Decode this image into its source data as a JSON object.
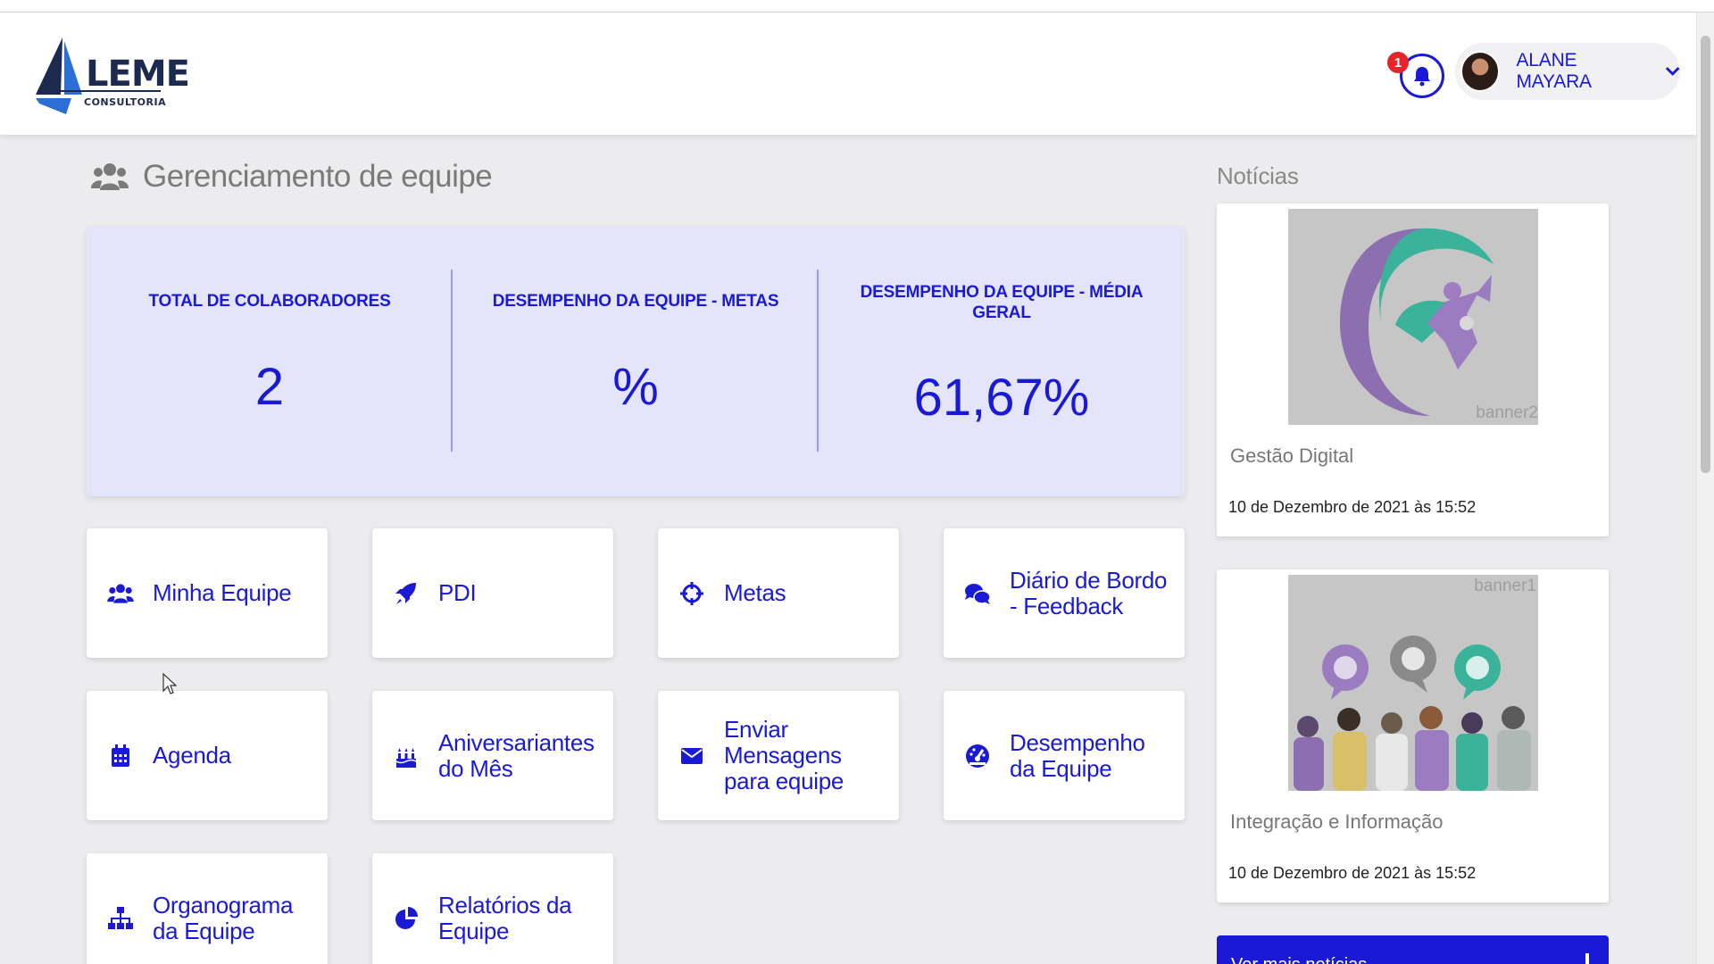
{
  "header": {
    "logo_text": "LEME",
    "logo_subtext": "CONSULTORIA",
    "notification_count": "1",
    "user_name": "ALANE MAYARA"
  },
  "page": {
    "title": "Gerenciamento de equipe"
  },
  "kpis": [
    {
      "label": "TOTAL DE COLABORADORES",
      "value": "2"
    },
    {
      "label": "DESEMPENHO DA EQUIPE - METAS",
      "value": "%"
    },
    {
      "label": "DESEMPENHO DA EQUIPE - MÉDIA GERAL",
      "value": "61,67%"
    }
  ],
  "tiles": [
    {
      "label": "Minha Equipe",
      "icon": "users-icon"
    },
    {
      "label": "PDI",
      "icon": "rocket-icon"
    },
    {
      "label": "Metas",
      "icon": "crosshair-icon"
    },
    {
      "label": "Diário de Bordo - Feedback",
      "icon": "comments-icon"
    },
    {
      "label": "Agenda",
      "icon": "calendar-icon"
    },
    {
      "label": "Aniversariantes do Mês",
      "icon": "birthday-cake-icon"
    },
    {
      "label": "Enviar Mensagens para equipe",
      "icon": "envelope-icon"
    },
    {
      "label": "Desempenho da Equipe",
      "icon": "gauge-icon"
    },
    {
      "label": "Organograma da Equipe",
      "icon": "org-chart-icon"
    },
    {
      "label": "Relatórios da Equipe",
      "icon": "pie-chart-icon"
    }
  ],
  "news": {
    "title": "Notícias",
    "items": [
      {
        "image_label": "banner2",
        "heading": "Gestão Digital",
        "date": "10 de Dezembro de 2021 às 15:52"
      },
      {
        "image_label": "banner1",
        "heading": "Integração e Informação",
        "date": "10 de Dezembro de 2021 às 15:52"
      }
    ],
    "more_label": "Ver mais notícias"
  },
  "colors": {
    "accent": "#1a1ad6",
    "kpi_background": "#e4e4fa",
    "page_background": "#ececee"
  }
}
